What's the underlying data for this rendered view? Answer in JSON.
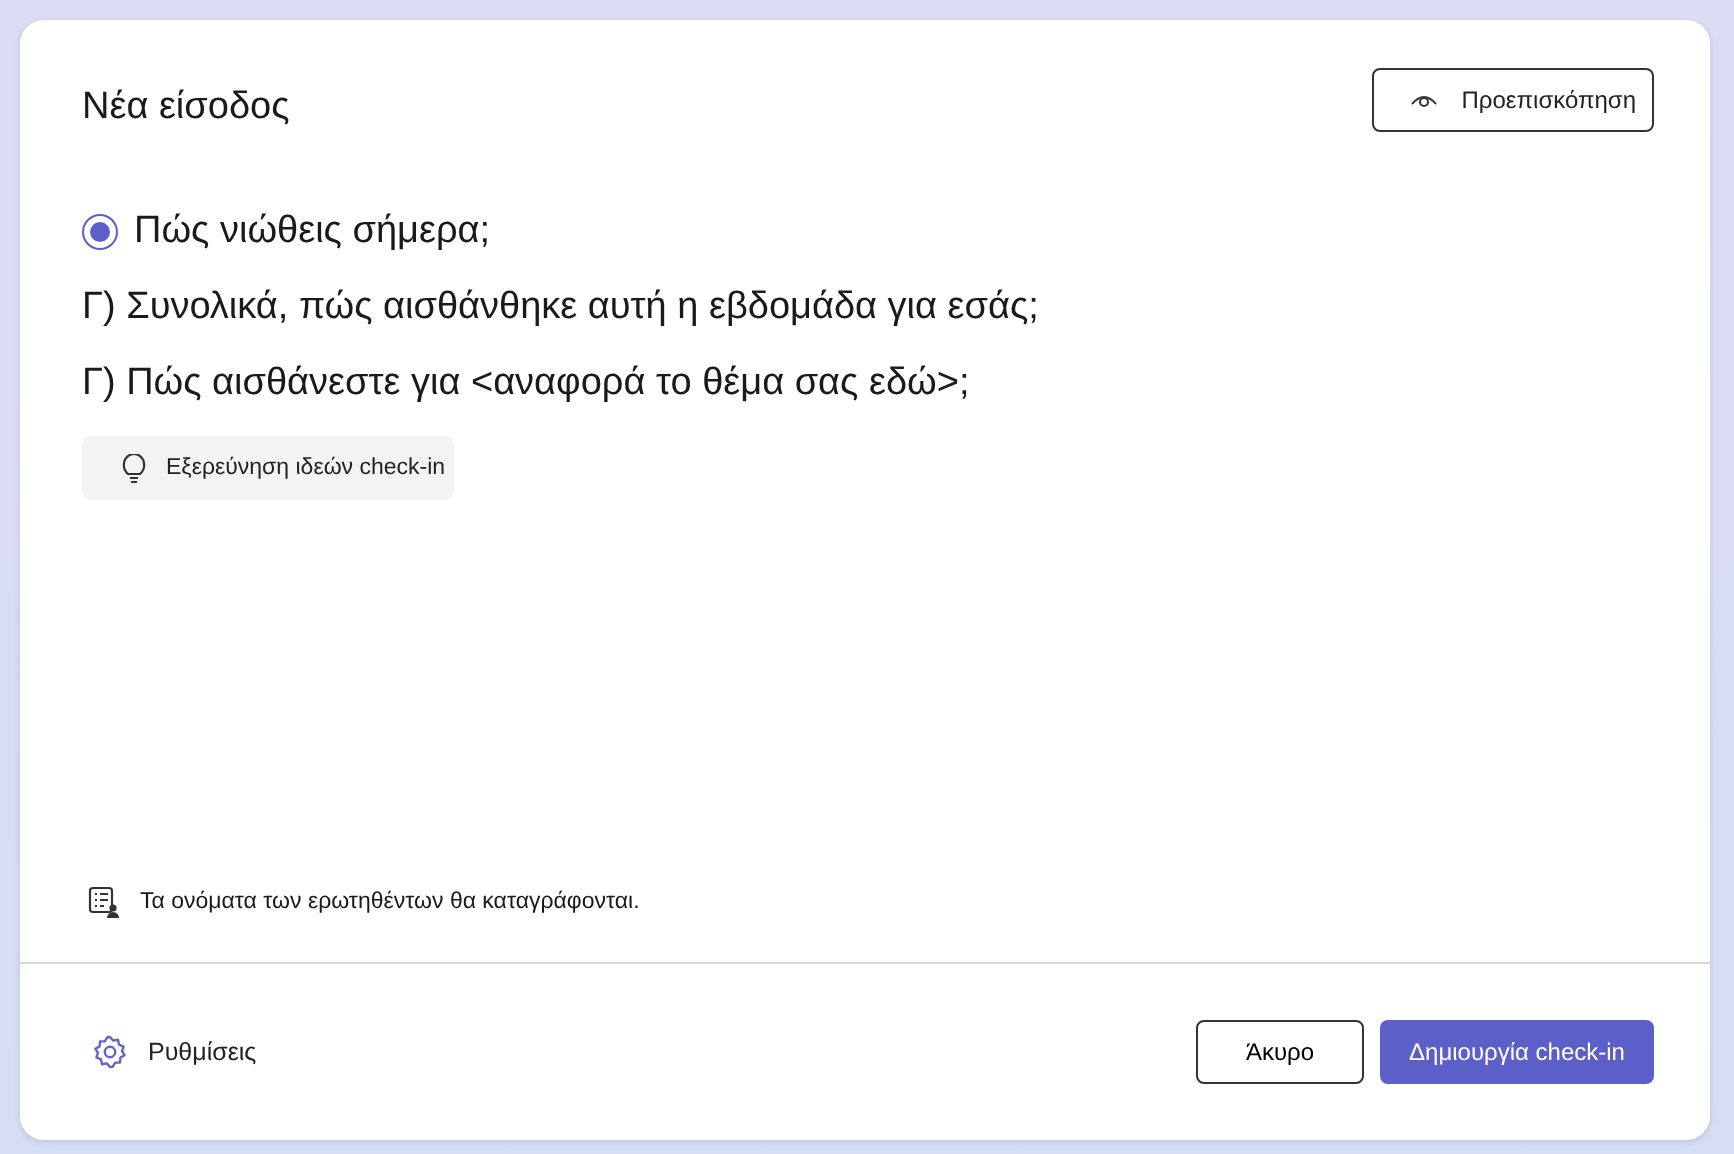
{
  "dialog": {
    "title": "Νέα είσοδος",
    "preview_button": "Προεπισκόπηση"
  },
  "questions": [
    {
      "kind": "radio",
      "selected": true,
      "text": "Πώς νιώθεις σήμερα;"
    },
    {
      "kind": "plain",
      "text": "Γ) Συνολικά, πώς αισθάνθηκε αυτή η εβδομάδα για εσάς;"
    },
    {
      "kind": "plain",
      "text": "Γ) Πώς αισθάνεστε για <αναφορά το θέμα σας εδώ>;"
    }
  ],
  "explore_button": "Εξερεύνηση ιδεών check-in",
  "note": "Τα ονόματα των ερωτηθέντων θα καταγράφονται.",
  "footer": {
    "settings": "Ρυθμίσεις",
    "cancel_button": "Άκυρο",
    "create_button": "Δημιουργία check-in"
  }
}
